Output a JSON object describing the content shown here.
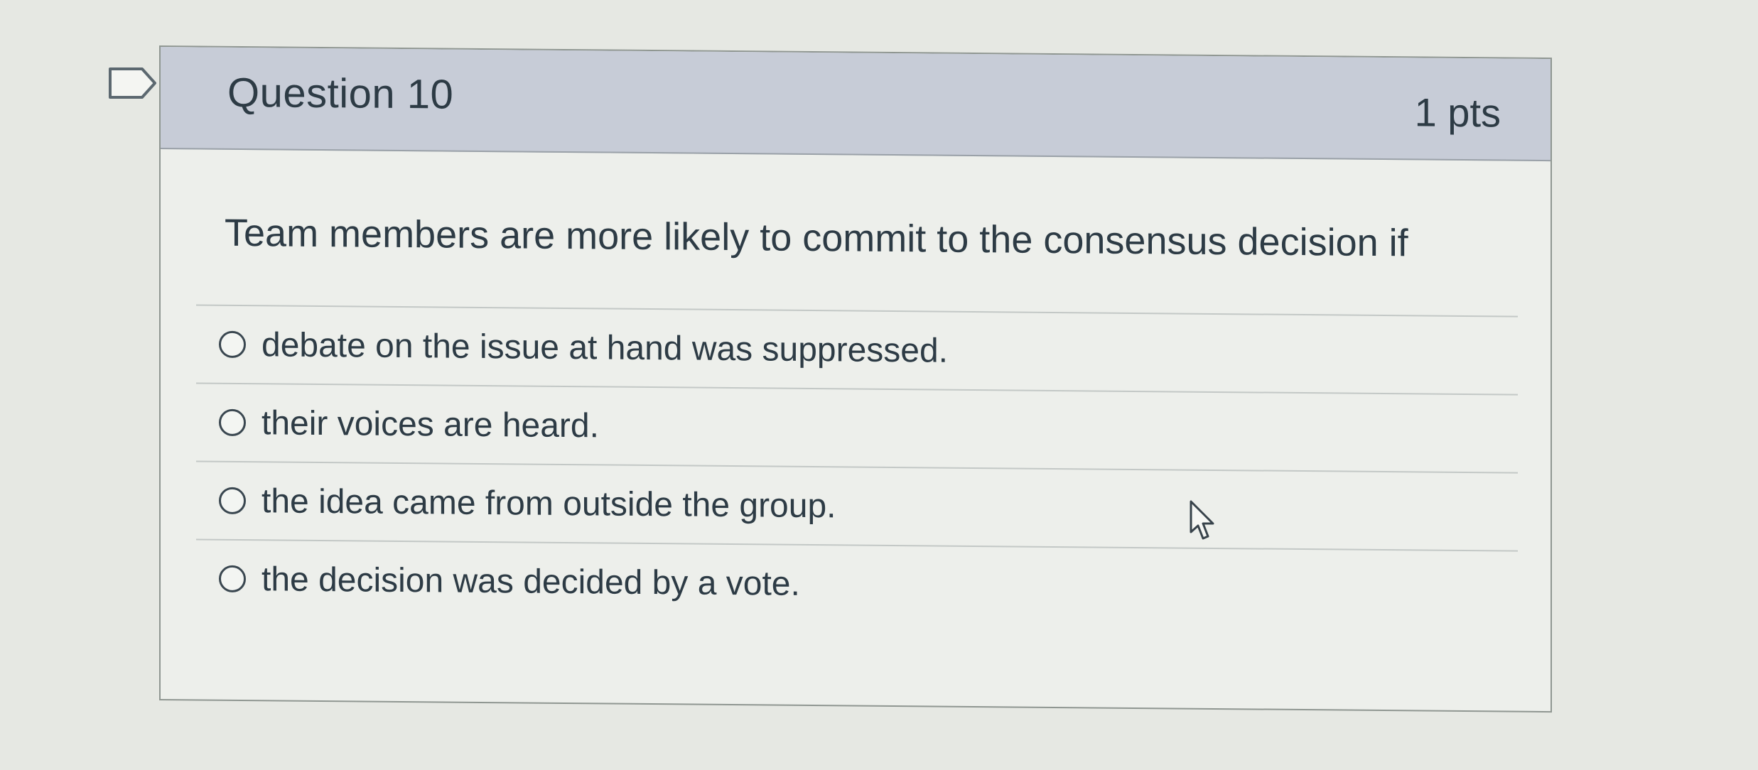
{
  "question": {
    "title": "Question 10",
    "points": "1 pts",
    "text": "Team members are more likely to commit to the consensus decision if",
    "bookmark_icon": "bookmark-flag-icon",
    "answers": [
      {
        "label": "debate on the issue at hand was suppressed.",
        "selected": false
      },
      {
        "label": "their voices are heard.",
        "selected": false
      },
      {
        "label": "the idea came from outside the group.",
        "selected": false
      },
      {
        "label": "the decision was decided by a vote.",
        "selected": false
      }
    ]
  },
  "colors": {
    "header_bg": "#c7ccd7",
    "text": "#2d3b45",
    "page_bg": "#e6e8e3"
  },
  "cursor_icon": "hand-pointer-cursor-icon"
}
